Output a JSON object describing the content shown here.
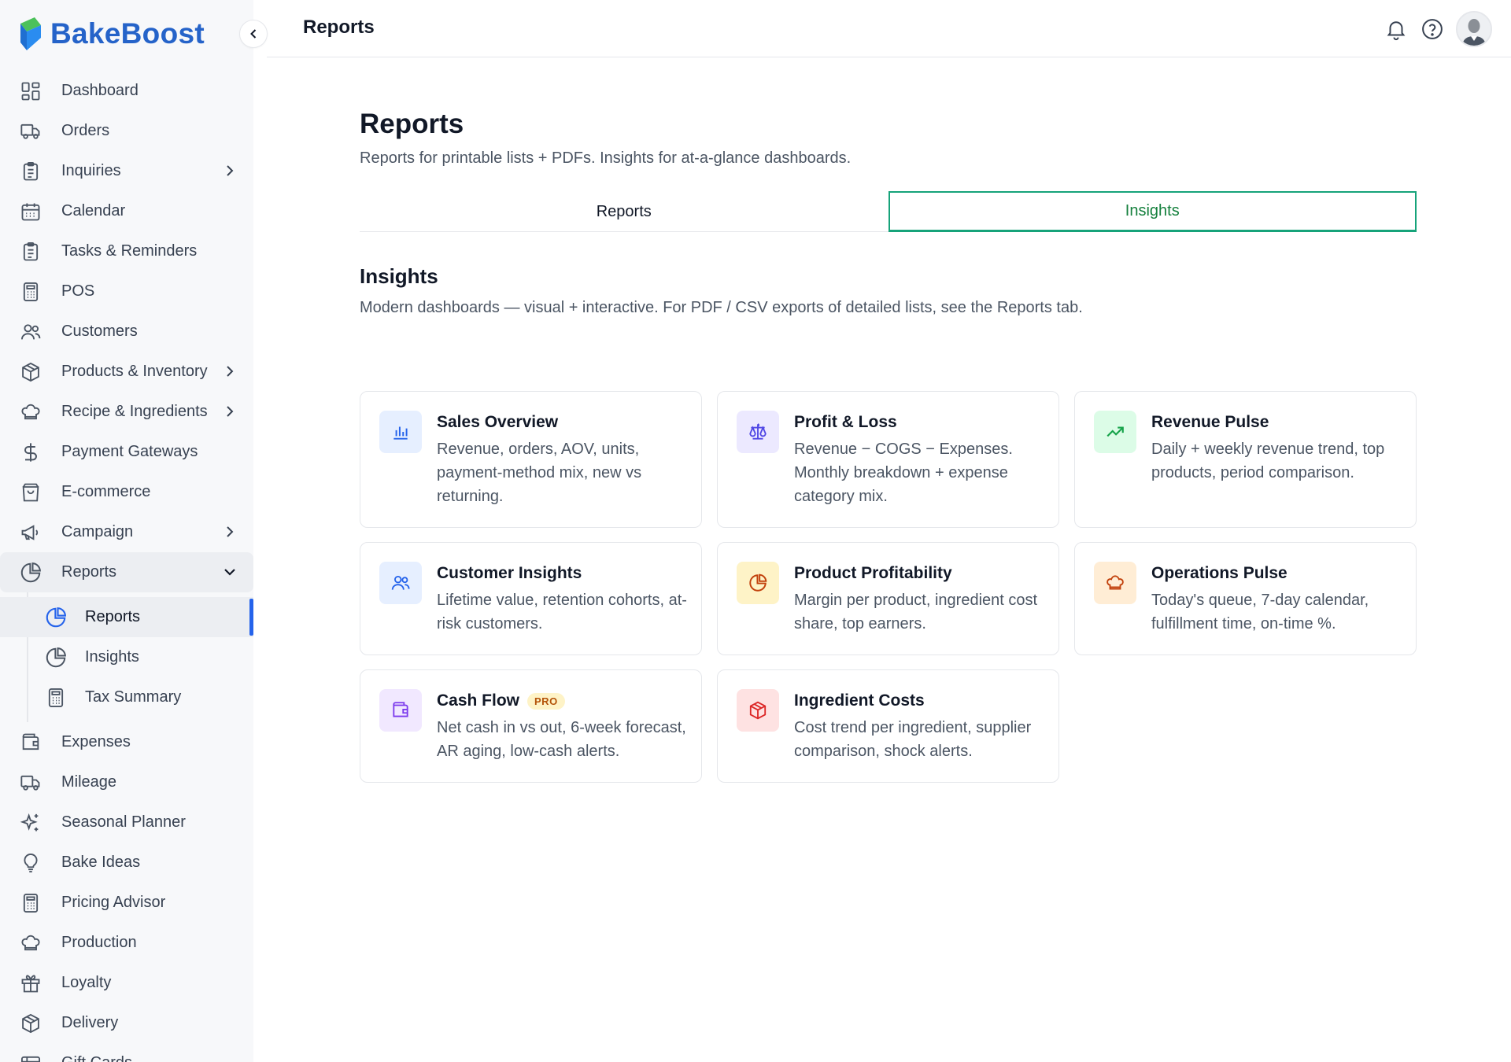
{
  "brand": {
    "name": "BakeBoost"
  },
  "topbar": {
    "title": "Reports"
  },
  "sidebar": {
    "items": [
      {
        "label": "Dashboard",
        "icon": "dashboard-icon"
      },
      {
        "label": "Orders",
        "icon": "truck-icon"
      },
      {
        "label": "Inquiries",
        "icon": "clipboard-icon",
        "has_children": true
      },
      {
        "label": "Calendar",
        "icon": "calendar-icon"
      },
      {
        "label": "Tasks & Reminders",
        "icon": "clipboard-icon"
      },
      {
        "label": "POS",
        "icon": "calculator-icon"
      },
      {
        "label": "Customers",
        "icon": "users-icon"
      },
      {
        "label": "Products & Inventory",
        "icon": "package-icon",
        "has_children": true
      },
      {
        "label": "Recipe & Ingredients",
        "icon": "chef-hat-icon",
        "has_children": true
      },
      {
        "label": "Payment Gateways",
        "icon": "dollar-icon"
      },
      {
        "label": "E-commerce",
        "icon": "shopping-bag-icon"
      },
      {
        "label": "Campaign",
        "icon": "megaphone-icon",
        "has_children": true
      }
    ],
    "reports_group": {
      "label": "Reports",
      "icon": "pie-chart-icon",
      "children": [
        {
          "label": "Reports",
          "icon": "pie-chart-icon",
          "active": true
        },
        {
          "label": "Insights",
          "icon": "pie-chart-icon"
        },
        {
          "label": "Tax Summary",
          "icon": "calculator-icon"
        }
      ]
    },
    "items_after": [
      {
        "label": "Expenses",
        "icon": "wallet-icon"
      },
      {
        "label": "Mileage",
        "icon": "truck-icon"
      },
      {
        "label": "Seasonal Planner",
        "icon": "sparkles-icon"
      },
      {
        "label": "Bake Ideas",
        "icon": "lightbulb-icon"
      },
      {
        "label": "Pricing Advisor",
        "icon": "calculator-icon"
      },
      {
        "label": "Production",
        "icon": "chef-hat-icon"
      },
      {
        "label": "Loyalty",
        "icon": "gift-icon"
      },
      {
        "label": "Delivery",
        "icon": "package-icon"
      },
      {
        "label": "Gift Cards",
        "icon": "gift-card-icon"
      }
    ]
  },
  "page": {
    "title": "Reports",
    "subtitle": "Reports for printable lists + PDFs. Insights for at-a-glance dashboards.",
    "tabs": [
      {
        "label": "Reports",
        "active": false
      },
      {
        "label": "Insights",
        "active": true
      }
    ],
    "section": {
      "title": "Insights",
      "subtitle": "Modern dashboards — visual + interactive. For PDF / CSV exports of detailed lists, see the Reports tab."
    },
    "cards": [
      {
        "title": "Sales Overview",
        "desc": "Revenue, orders, AOV, units, payment-method mix, new vs returning.",
        "icon": "bar-chart-icon",
        "icon_bg": "#e6efff",
        "icon_color": "#2563eb"
      },
      {
        "title": "Profit & Loss",
        "desc": "Revenue − COGS − Expenses. Monthly breakdown + expense category mix.",
        "icon": "scale-icon",
        "icon_bg": "#ece9ff",
        "icon_color": "#4f46e5"
      },
      {
        "title": "Revenue Pulse",
        "desc": "Daily + weekly revenue trend, top products, period comparison.",
        "icon": "trending-up-icon",
        "icon_bg": "#dcfce7",
        "icon_color": "#16a34a"
      },
      {
        "title": "Customer Insights",
        "desc": "Lifetime value, retention cohorts, at-risk customers.",
        "icon": "users-icon",
        "icon_bg": "#e6efff",
        "icon_color": "#2563eb"
      },
      {
        "title": "Product Profitability",
        "desc": "Margin per product, ingredient cost share, top earners.",
        "icon": "pie-chart-icon",
        "icon_bg": "#fef3c7",
        "icon_color": "#c2410c"
      },
      {
        "title": "Operations Pulse",
        "desc": "Today's queue, 7-day calendar, fulfillment time, on-time %.",
        "icon": "chef-hat-icon",
        "icon_bg": "#ffedd5",
        "icon_color": "#c2410c"
      },
      {
        "title": "Cash Flow",
        "badge": "PRO",
        "desc": "Net cash in vs out, 6-week forecast, AR aging, low-cash alerts.",
        "icon": "wallet-icon",
        "icon_bg": "#f1e8ff",
        "icon_color": "#7c3aed"
      },
      {
        "title": "Ingredient Costs",
        "desc": "Cost trend per ingredient, supplier comparison, shock alerts.",
        "icon": "package-icon",
        "icon_bg": "#fee2e2",
        "icon_color": "#dc2626"
      }
    ]
  },
  "colors": {
    "brand": "#2563c9",
    "accent_tab": "#16a37a",
    "active_rail": "#2563eb"
  }
}
